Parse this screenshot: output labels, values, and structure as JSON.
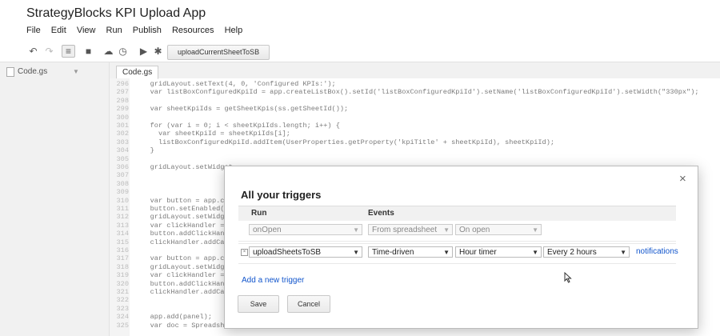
{
  "app": {
    "title": "StrategyBlocks KPI Upload App"
  },
  "menu": [
    "File",
    "Edit",
    "View",
    "Run",
    "Publish",
    "Resources",
    "Help"
  ],
  "toolbar": {
    "function_select": "uploadCurrentSheetToSB"
  },
  "sidebar": {
    "file": "Code.gs"
  },
  "editor": {
    "tab": "Code.gs",
    "lines": [
      {
        "n": "296",
        "t": "    gridLayout.setText(4, 0, 'Configured KPIs:');"
      },
      {
        "n": "297",
        "t": "    var listBoxConfiguredKpiId = app.createListBox().setId('listBoxConfiguredKpiId').setName('listBoxConfiguredKpiId').setWidth(\"330px\");"
      },
      {
        "n": "298",
        "t": ""
      },
      {
        "n": "299",
        "t": "    var sheetKpiIds = getSheetKpis(ss.getSheetId());"
      },
      {
        "n": "300",
        "t": ""
      },
      {
        "n": "301",
        "t": "    for (var i = 0; i < sheetKpiIds.length; i++) {"
      },
      {
        "n": "302",
        "t": "      var sheetKpiId = sheetKpiIds[i];"
      },
      {
        "n": "303",
        "t": "      listBoxConfiguredKpiId.addItem(UserProperties.getProperty('kpiTitle' + sheetKpiId), sheetKpiId);"
      },
      {
        "n": "304",
        "t": "    }"
      },
      {
        "n": "305",
        "t": ""
      },
      {
        "n": "306",
        "t": "    gridLayout.setWidget"
      },
      {
        "n": "307",
        "t": ""
      },
      {
        "n": "308",
        "t": ""
      },
      {
        "n": "309",
        "t": ""
      },
      {
        "n": "310",
        "t": "    var button = app.cre"
      },
      {
        "n": "311",
        "t": "    button.setEnabled(sh"
      },
      {
        "n": "312",
        "t": "    gridLayout.setWidget"
      },
      {
        "n": "313",
        "t": "    var clickHandler = a"
      },
      {
        "n": "314",
        "t": "    button.addClickHandl"
      },
      {
        "n": "315",
        "t": "    clickHandler.addCall"
      },
      {
        "n": "316",
        "t": ""
      },
      {
        "n": "317",
        "t": "    var button = app.cre"
      },
      {
        "n": "318",
        "t": "    gridLayout.setWidget"
      },
      {
        "n": "319",
        "t": "    var clickHandler = a"
      },
      {
        "n": "320",
        "t": "    button.addClickHandl"
      },
      {
        "n": "321",
        "t": "    clickHandler.addCall"
      },
      {
        "n": "322",
        "t": ""
      },
      {
        "n": "323",
        "t": ""
      },
      {
        "n": "324",
        "t": "    app.add(panel);"
      },
      {
        "n": "325",
        "t": "    var doc = SpreadsheetApp.getActive();"
      }
    ]
  },
  "dialog": {
    "close": "×",
    "title": "All your triggers",
    "col_run": "Run",
    "col_events": "Events",
    "triggers": [
      {
        "run": "onOpen",
        "source": "From spreadsheet",
        "event": "On open",
        "disabled": true
      },
      {
        "run": "uploadSheetsToSB",
        "source": "Time-driven",
        "event": "Hour timer",
        "interval": "Every 2 hours",
        "notifications": "notifications"
      }
    ],
    "delete_icon": "×",
    "add_trigger": "Add a new trigger",
    "save": "Save",
    "cancel": "Cancel"
  },
  "colors": {
    "link": "#1155cc",
    "keyword": "#7f0055",
    "variable": "#0000c0",
    "string": "#a31515"
  }
}
